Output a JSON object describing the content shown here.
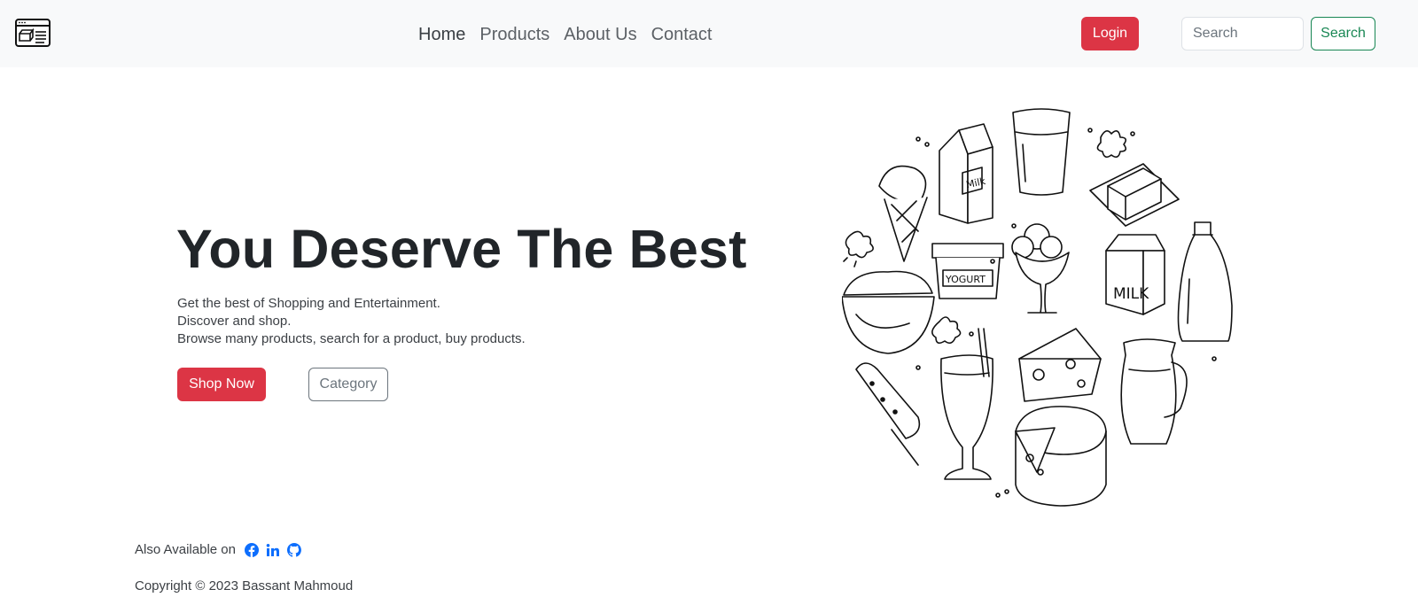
{
  "nav": {
    "links": [
      "Home",
      "Products",
      "About Us",
      "Contact"
    ],
    "login_label": "Login",
    "search_placeholder": "Search",
    "search_label": "Search"
  },
  "hero": {
    "title": "You Deserve The Best",
    "lines": [
      "Get the best of Shopping and Entertainment.",
      "Discover and shop.",
      "Browse many products, search for a product, buy products."
    ],
    "shop_label": "Shop Now",
    "category_label": "Category",
    "illustration_labels": [
      "Milk",
      "YOGURT",
      "MILK"
    ]
  },
  "footer": {
    "available_label": "Also Available on",
    "social_icons": [
      "facebook-icon",
      "linkedin-icon",
      "github-icon"
    ],
    "copyright": "Copyright © 2023 Bassant Mahmoud"
  },
  "colors": {
    "navbar_bg": "#f8f9fa",
    "danger": "#dc3545",
    "success": "#198754",
    "social": "#0d6efd"
  }
}
